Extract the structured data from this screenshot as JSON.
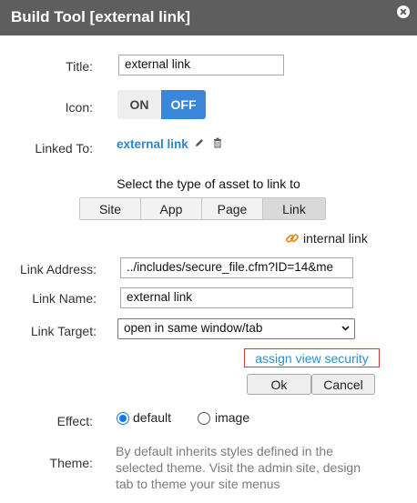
{
  "dialog": {
    "title": "Build Tool [external link]"
  },
  "form": {
    "title_label": "Title:",
    "title_value": "external link",
    "icon_label": "Icon:",
    "icon_on": "ON",
    "icon_off": "OFF",
    "icon_state": "OFF",
    "linked_label": "Linked To:",
    "linked_value": "external link",
    "asset_heading": "Select the type of asset to link to",
    "asset_types": [
      "Site",
      "App",
      "Page",
      "Link"
    ],
    "asset_selected": "Link",
    "internal_link": "internal link",
    "address_label": "Link Address:",
    "address_value": "../includes/secure_file.cfm?ID=14&me",
    "name_label": "Link Name:",
    "name_value": "external link",
    "target_label": "Link Target:",
    "target_value": "open in same window/tab",
    "assign_security": "assign view security",
    "ok": "Ok",
    "cancel": "Cancel",
    "effect_label": "Effect:",
    "effect_default": "default",
    "effect_image": "image",
    "effect_selected": "default",
    "theme_label": "Theme:",
    "theme_text": "By default inherits styles defined in the selected theme. Visit the admin site, design tab to theme your site menus"
  },
  "colors": {
    "titlebar": "#5e5e5e",
    "accent": "#3a86d8",
    "link": "#2a86c9",
    "security_border": "#d43a3a"
  },
  "icons": [
    "close-icon",
    "pencil-icon",
    "trash-icon",
    "chain-link-icon",
    "chevron-down-icon"
  ]
}
